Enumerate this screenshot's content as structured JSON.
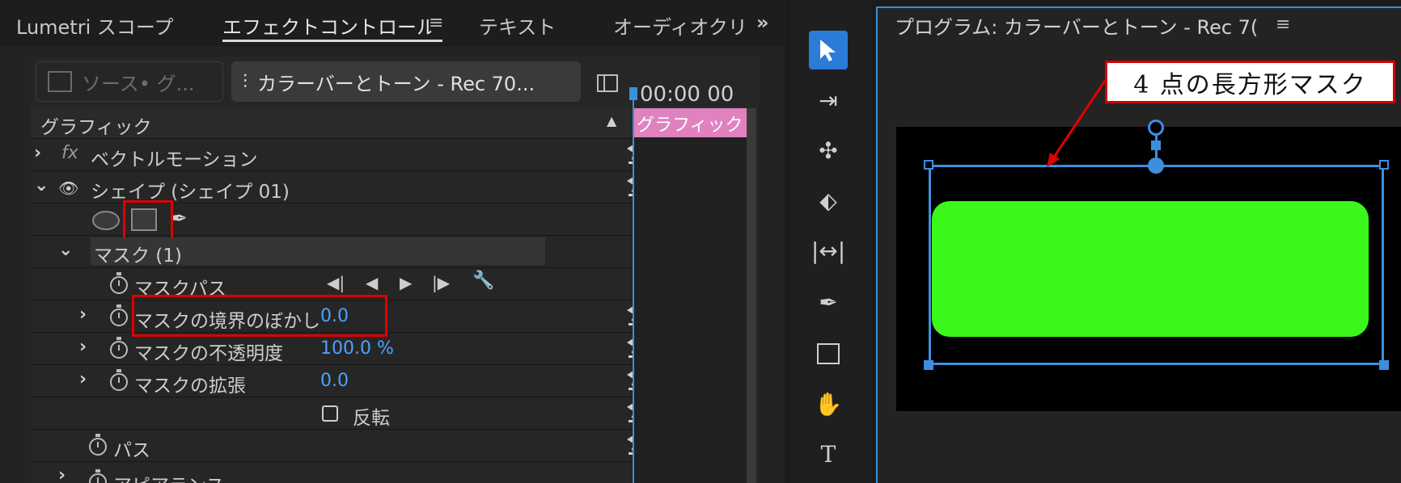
{
  "tabs": [
    {
      "label": "Lumetri スコープ"
    },
    {
      "label": "エフェクトコントロール"
    },
    {
      "label": "テキスト"
    },
    {
      "label": "オーディオクリ"
    }
  ],
  "source": {
    "source_label": "ソース• グ...",
    "sequence_label": "カラーバーとトーン - Rec 70..."
  },
  "timecode": "00:00 00",
  "clip_label": "グラフィック",
  "section_label": "グラフィック",
  "rows": {
    "vector_motion": "ベクトルモーション",
    "shape": "シェイプ (シェイプ 01)",
    "mask": "マスク (1)",
    "mask_path": "マスクパス",
    "mask_feather": "マスクの境界のぼかし",
    "mask_feather_val": "0.0",
    "mask_opacity": "マスクの不透明度",
    "mask_opacity_val": "100.0 %",
    "mask_expansion": "マスクの拡張",
    "mask_expansion_val": "0.0",
    "invert": "反転",
    "path": "パス",
    "appearance": "アピアランス"
  },
  "program": {
    "title": "プログラム: カラーバーとトーン - Rec 7("
  },
  "annotation": {
    "callout": "4 点の長方形マスク"
  },
  "colors": {
    "accent": "#3e8ee0",
    "shape_fill": "#3af81a",
    "highlight": "#e00000"
  }
}
